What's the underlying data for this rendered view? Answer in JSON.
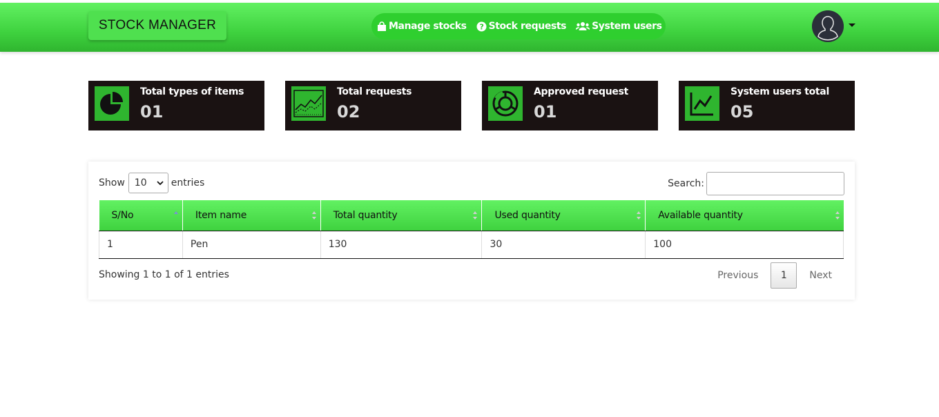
{
  "header": {
    "brand": "STOCK MANAGER",
    "nav": [
      {
        "label": "Manage stocks",
        "icon": "shopping-bag-icon"
      },
      {
        "label": "Stock requests",
        "icon": "question-circle-icon"
      },
      {
        "label": "System users",
        "icon": "users-icon"
      }
    ],
    "avatar_icon": "user-avatar-icon"
  },
  "stats": [
    {
      "label": "Total types of items",
      "value": "01",
      "icon": "pie-chart-icon"
    },
    {
      "label": "Total requests",
      "value": "02",
      "icon": "area-chart-icon"
    },
    {
      "label": "Approved request",
      "value": "01",
      "icon": "donut-chart-icon"
    },
    {
      "label": "System users total",
      "value": "05",
      "icon": "line-chart-icon"
    }
  ],
  "table": {
    "length_prefix": "Show",
    "length_value": "10",
    "length_suffix": "entries",
    "search_label": "Search:",
    "search_value": "",
    "columns": [
      "S/No",
      "Item name",
      "Total quantity",
      "Used quantity",
      "Available quantity"
    ],
    "rows": [
      [
        "1",
        "Pen",
        "130",
        "30",
        "100"
      ]
    ],
    "info": "Showing 1 to 1 of 1 entries",
    "pagination": {
      "previous": "Previous",
      "current_page": "1",
      "next": "Next"
    }
  },
  "colors": {
    "accent_green": "#3fd23f",
    "card_bg": "#1a1212",
    "icon_green": "#2fb52f"
  }
}
